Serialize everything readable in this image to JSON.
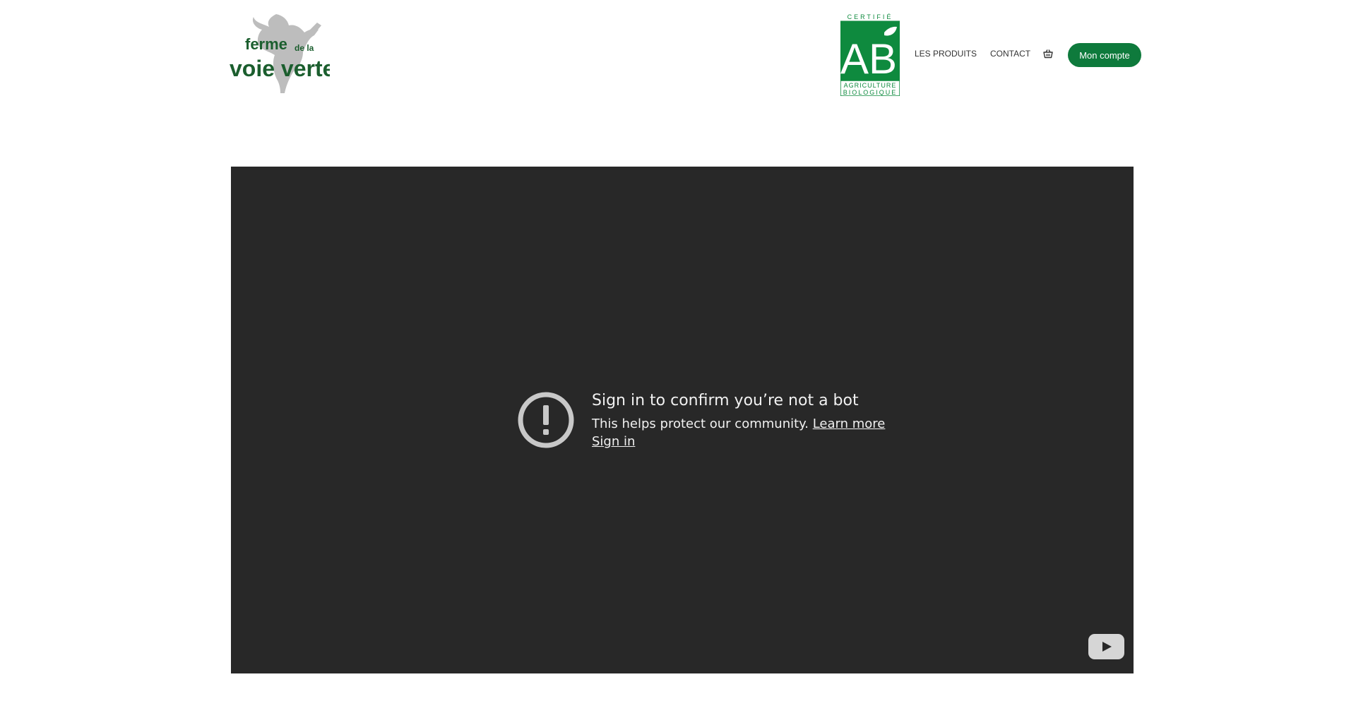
{
  "header": {
    "logo_alt": "ferme de la voie verte",
    "logo_text": {
      "line1": "ferme",
      "line2": "de la",
      "line3": "voie verte"
    },
    "badge": {
      "top": "CERTIFIÉ",
      "letters": "AB",
      "bottom1": "AGRICULTURE",
      "bottom2": "BIOLOGIQUE"
    },
    "nav": {
      "products": "LES PRODUITS",
      "contact": "CONTACT",
      "cart_icon": "shopping-basket-icon",
      "account": "Mon compte"
    }
  },
  "video": {
    "title": "Sign in to confirm you’re not a bot",
    "body": "This helps protect our community.",
    "learn_more": "Learn more",
    "sign_in": "Sign in",
    "warning_icon": "exclamation-circle-icon",
    "player_logo": "youtube-play-icon"
  },
  "colors": {
    "brand_green": "#0e7a3c",
    "logo_green": "#1b5e2e",
    "video_bg": "#282828",
    "text_light": "#f1f1f1"
  }
}
